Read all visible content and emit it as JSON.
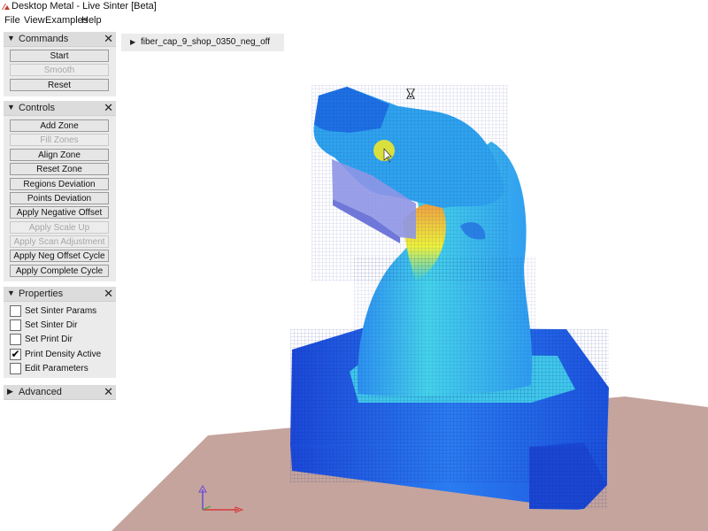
{
  "window": {
    "title": "Desktop Metal - Live Sinter [Beta]"
  },
  "menu": {
    "items": [
      "File",
      "View",
      "Examples",
      "Help"
    ]
  },
  "file_tree": {
    "label": "fiber_cap_9_shop_0350_neg_off"
  },
  "panels": {
    "commands": {
      "title": "Commands",
      "buttons": [
        {
          "label": "Start",
          "enabled": true
        },
        {
          "label": "Smooth",
          "enabled": false
        },
        {
          "label": "Reset",
          "enabled": true
        }
      ]
    },
    "controls": {
      "title": "Controls",
      "buttons": [
        {
          "label": "Add Zone",
          "enabled": true
        },
        {
          "label": "Fill Zones",
          "enabled": false
        },
        {
          "label": "Align Zone",
          "enabled": true
        },
        {
          "label": "Reset Zone",
          "enabled": true
        },
        {
          "label": "Regions Deviation",
          "enabled": true
        },
        {
          "label": "Points Deviation",
          "enabled": true
        },
        {
          "label": "Apply Negative Offset",
          "enabled": true
        },
        {
          "label": "Apply Scale Up",
          "enabled": false
        },
        {
          "label": "Apply Scan Adjustment",
          "enabled": false
        },
        {
          "label": "Apply Neg Offset Cycle",
          "enabled": true
        },
        {
          "label": "Apply Complete Cycle",
          "enabled": true
        }
      ]
    },
    "properties": {
      "title": "Properties",
      "checkboxes": [
        {
          "label": "Set Sinter Params",
          "checked": false
        },
        {
          "label": "Set Sinter Dir",
          "checked": false
        },
        {
          "label": "Set Print Dir",
          "checked": false
        },
        {
          "label": "Print Density Active",
          "checked": true
        },
        {
          "label": "Edit Parameters",
          "checked": false
        }
      ]
    },
    "advanced": {
      "title": "Advanced"
    }
  },
  "colors": {
    "panel_bg": "#ebebeb",
    "panel_header": "#dcdcdc",
    "floor": "#c5a49d",
    "model_blue": "#1e5ee6",
    "model_cyan": "#3ad0e8",
    "hot_yellow": "#eef23a",
    "hot_orange": "#f0a040",
    "tray": "#8e96e6",
    "highlight": "#ece72a"
  }
}
